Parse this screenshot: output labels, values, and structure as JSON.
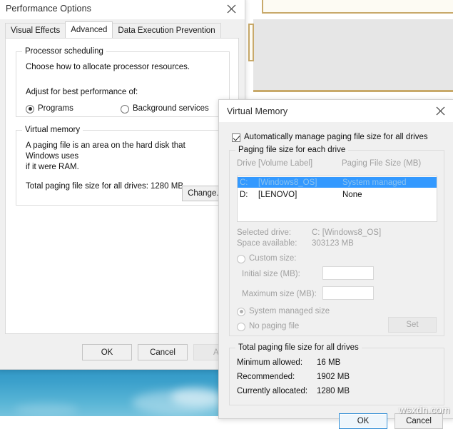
{
  "performance_options": {
    "title": "Performance Options",
    "close_icon": "close-icon",
    "tabs": [
      {
        "label": "Visual Effects",
        "active": false
      },
      {
        "label": "Advanced",
        "active": true
      },
      {
        "label": "Data Execution Prevention",
        "active": false
      }
    ],
    "processor_scheduling": {
      "legend": "Processor scheduling",
      "description": "Choose how to allocate processor resources.",
      "adjust_label": "Adjust for best performance of:",
      "options": [
        {
          "label": "Programs",
          "selected": true
        },
        {
          "label": "Background services",
          "selected": false
        }
      ]
    },
    "virtual_memory": {
      "legend": "Virtual memory",
      "description_line1": "A paging file is an area on the hard disk that Windows uses",
      "description_line2": "if it were RAM.",
      "total_label": "Total paging file size for all drives:",
      "total_value": "1280 MB",
      "change_button": "Change..."
    },
    "buttons": {
      "ok": "OK",
      "cancel": "Cancel",
      "apply": "Ap"
    }
  },
  "virtual_memory_dialog": {
    "title": "Virtual Memory",
    "close_icon": "close-icon",
    "auto_manage": {
      "label": "Automatically manage paging file size for all drives",
      "checked": true
    },
    "paging_group": {
      "legend": "Paging file size for each drive",
      "columns": {
        "drive": "Drive  [Volume Label]",
        "size": "Paging File Size (MB)"
      },
      "rows": [
        {
          "drive": "C:",
          "label": "[Windows8_OS]",
          "size": "System managed",
          "selected": true
        },
        {
          "drive": "D:",
          "label": "[LENOVO]",
          "size": "None",
          "selected": false
        }
      ],
      "selected_drive_label": "Selected drive:",
      "selected_drive_value": "C:  [Windows8_OS]",
      "space_available_label": "Space available:",
      "space_available_value": "303123 MB",
      "custom_size": {
        "label": "Custom size:",
        "selected": false
      },
      "initial_size_label": "Initial size (MB):",
      "initial_size_value": "",
      "maximum_size_label": "Maximum size (MB):",
      "maximum_size_value": "",
      "system_managed": {
        "label": "System managed size",
        "selected": true
      },
      "no_paging_file": {
        "label": "No paging file",
        "selected": false
      },
      "set_button": "Set"
    },
    "total_group": {
      "legend": "Total paging file size for all drives",
      "minimum_label": "Minimum allowed:",
      "minimum_value": "16 MB",
      "recommended_label": "Recommended:",
      "recommended_value": "1902 MB",
      "allocated_label": "Currently allocated:",
      "allocated_value": "1280 MB"
    },
    "buttons": {
      "ok": "OK",
      "cancel": "Cancel"
    }
  },
  "watermark": "wsxdn.com",
  "colors": {
    "selection_blue": "#3399ff",
    "default_button_border": "#2a8ad4",
    "window_bg": "#f0f0f0",
    "bg_window_border": "#c8a96a",
    "wallpaper": "#3ba0cb"
  }
}
